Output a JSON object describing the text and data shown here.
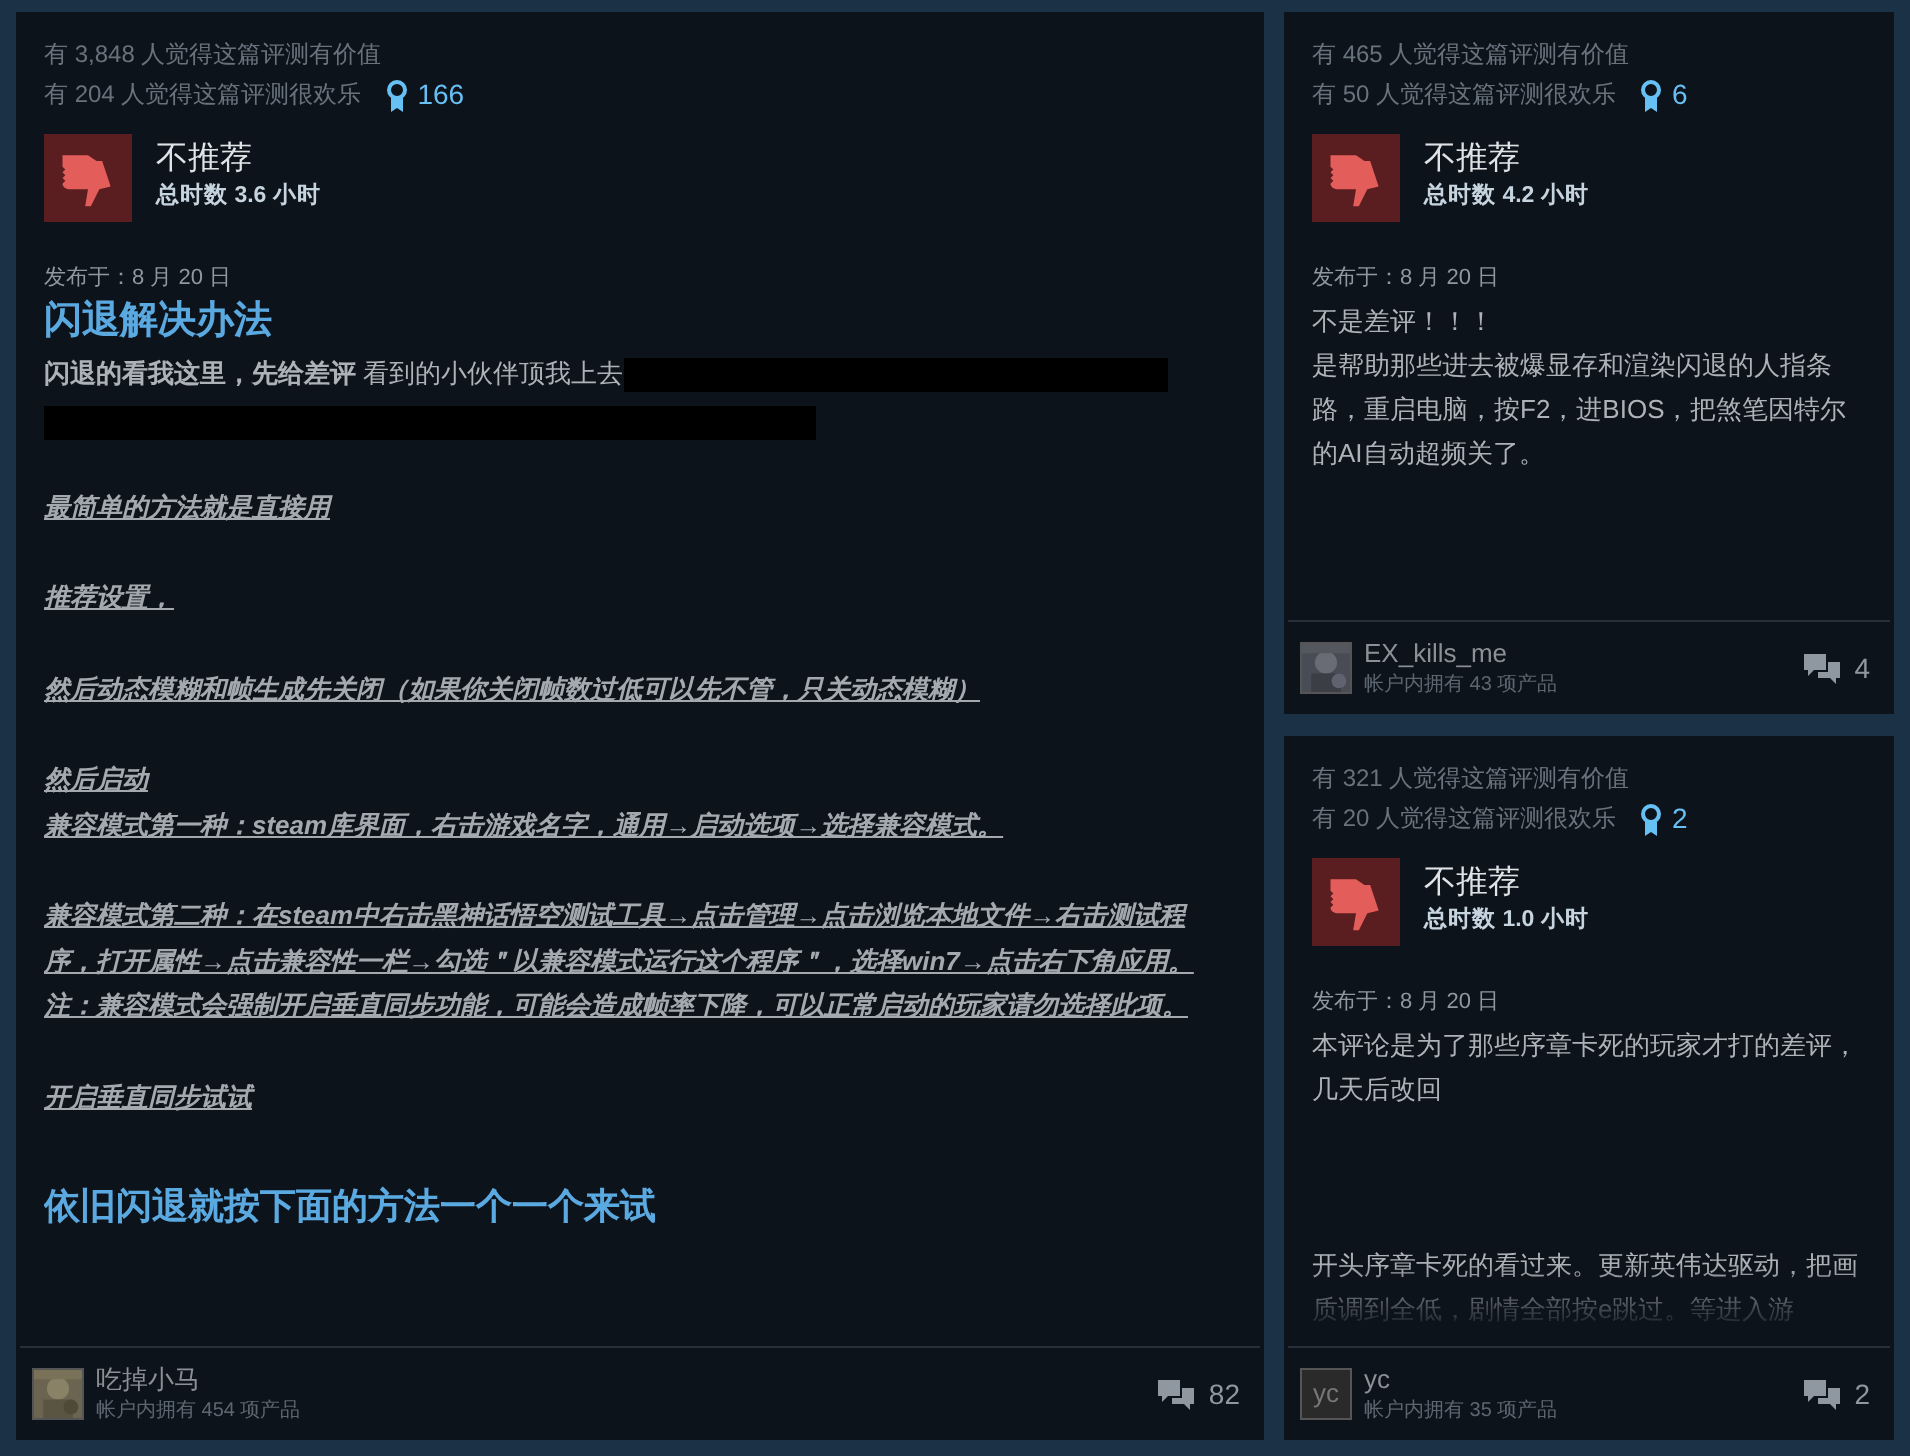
{
  "reviews": [
    {
      "helpful": "有 3,848 人觉得这篇评测有价值",
      "funny": "有 204 人觉得这篇评测很欢乐",
      "awards": "166",
      "recommended": false,
      "verdict": "不推荐",
      "hours": "总时数 3.6 小时",
      "posted": "发布于：8 月 20 日",
      "title": "闪退解决办法",
      "blocks": [
        {
          "kind": "paragraph",
          "text": "**闪退的看我这里，先给差评** 看到的小伙伴顶我上去",
          "spoiler": true
        },
        {
          "kind": "emphasis",
          "lines": [
            "最简单的方法就是直接用"
          ]
        },
        {
          "kind": "emphasis",
          "lines": [
            "推荐设置，"
          ]
        },
        {
          "kind": "emphasis",
          "lines": [
            "然后动态模糊和帧生成先关闭（如果你关闭帧数过低可以先不管，只关动态模糊）"
          ]
        },
        {
          "kind": "emphasis",
          "lines": [
            "然后启动",
            "兼容模式第一种：steam库界面，右击游戏名字，通用→启动选项→选择兼容模式。"
          ]
        },
        {
          "kind": "emphasis",
          "lines": [
            "兼容模式第二种：在steam中右击黑神话悟空测试工具→点击管理→点击浏览本地文件→右击测试程序，打开属性→点击兼容性一栏→勾选＂以兼容模式运行这个程序＂，选择win7→点击右下角应用。注：兼容模式会强制开启垂直同步功能，可能会造成帧率下降，可以正常启动的玩家请勿选择此项。"
          ]
        },
        {
          "kind": "emphasis",
          "lines": [
            "开启垂直同步试试"
          ]
        },
        {
          "kind": "heading",
          "text": "依旧闪退就按下面的方法一个一个来试"
        }
      ],
      "author": {
        "name": "吃掉小马",
        "products": "帐户内拥有 454 项产品"
      },
      "comments": "82"
    },
    {
      "helpful": "有 465 人觉得这篇评测有价值",
      "funny": "有 50 人觉得这篇评测很欢乐",
      "awards": "6",
      "recommended": false,
      "verdict": "不推荐",
      "hours": "总时数 4.2 小时",
      "posted": "发布于：8 月 20 日",
      "blocks": [
        {
          "kind": "plain",
          "lines": [
            "不是差评！！！",
            "是帮助那些进去被爆显存和渲染闪退的人指条路，重启电脑，按F2，进BIOS，把煞笔因特尔的AI自动超频关了。"
          ]
        }
      ],
      "author": {
        "name": "EX_kills_me",
        "products": "帐户内拥有 43 项产品"
      },
      "comments": "4"
    },
    {
      "helpful": "有 321 人觉得这篇评测有价值",
      "funny": "有 20 人觉得这篇评测很欢乐",
      "awards": "2",
      "recommended": false,
      "verdict": "不推荐",
      "hours": "总时数 1.0 小时",
      "posted": "发布于：8 月 20 日",
      "faded": true,
      "blocks": [
        {
          "kind": "plain",
          "lines": [
            "本评论是为了那些序章卡死的玩家才打的差评，几天后改回"
          ]
        },
        {
          "kind": "plain",
          "lines": [
            "开头序章卡死的看过来。更新英伟达驱动，把画质调到全低，剧情全部按e跳过。等进入游"
          ]
        }
      ],
      "author": {
        "name": "yc",
        "products": "帐户内拥有 35 项产品",
        "avatar": {
          "kind": "letters",
          "text": "yc"
        }
      },
      "comments": "2"
    }
  ]
}
